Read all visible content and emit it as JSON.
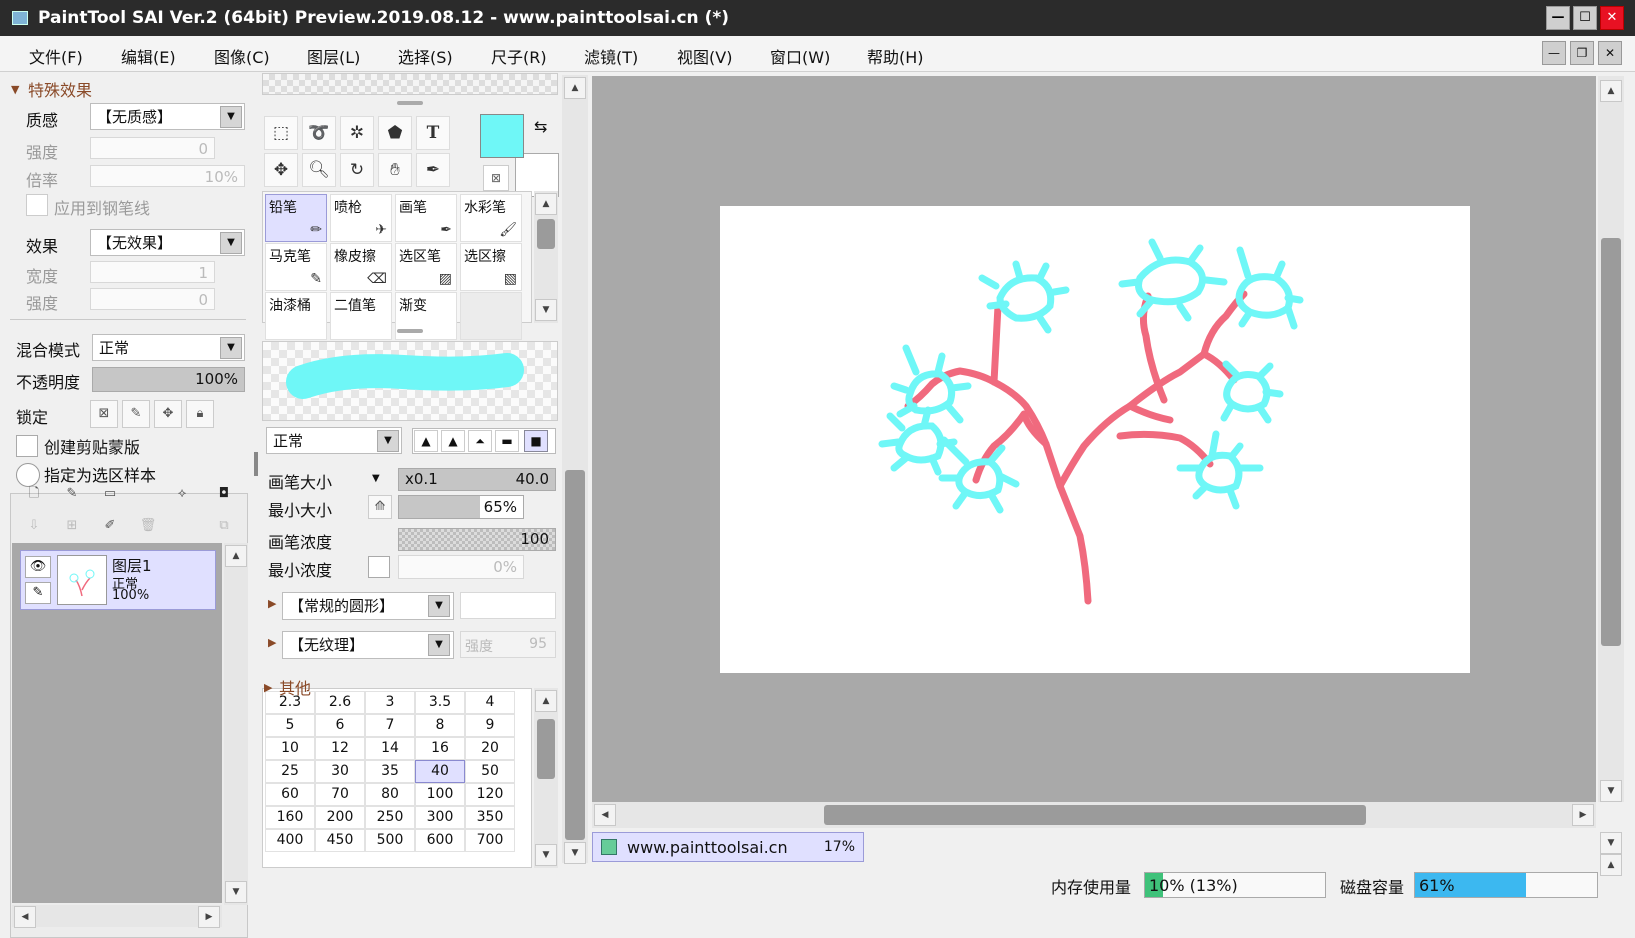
{
  "window": {
    "title": "PaintTool SAI Ver.2 (64bit) Preview.2019.08.12 - www.painttoolsai.cn (*)"
  },
  "menu": [
    "文件(F)",
    "编辑(E)",
    "图像(C)",
    "图层(L)",
    "选择(S)",
    "尺子(R)",
    "滤镜(T)",
    "视图(V)",
    "窗口(W)",
    "帮助(H)"
  ],
  "effects": {
    "header": "特殊效果",
    "texture_label": "质感",
    "texture_value": "【无质感】",
    "strength_label": "强度",
    "strength_value": "0",
    "scale_label": "倍率",
    "scale_value": "10%",
    "apply_pen": "应用到钢笔线",
    "effect_label": "效果",
    "effect_value": "【无效果】",
    "width_label": "宽度",
    "width_value": "1",
    "strength2_label": "强度",
    "strength2_value": "0"
  },
  "layer_props": {
    "blend_label": "混合模式",
    "blend_value": "正常",
    "opacity_label": "不透明度",
    "opacity_value": "100%",
    "opacity": 1.0,
    "lock_label": "锁定",
    "clip": "创建剪贴蒙版",
    "sample": "指定为选区样本"
  },
  "layers": [
    {
      "name": "图层1",
      "mode": "正常",
      "opacity": "100%"
    }
  ],
  "colors": {
    "primary": "#6ff7f7",
    "secondary": "#ffffff",
    "accent": "#f06a7e",
    "select": "#e0e0ff"
  },
  "brushes": [
    [
      "铅笔",
      "喷枪",
      "画笔",
      "水彩笔"
    ],
    [
      "马克笔",
      "橡皮擦",
      "选区笔",
      "选区擦"
    ],
    [
      "油漆桶",
      "二值笔",
      "渐变",
      ""
    ]
  ],
  "brush_settings": {
    "blend": "正常",
    "size_label": "画笔大小",
    "size_mult": "x0.1",
    "size_value": "40.0",
    "min_size_label": "最小大小",
    "min_size_value": "65%",
    "min_size": 0.65,
    "density_label": "画笔浓度",
    "density_value": "100",
    "min_density_label": "最小浓度",
    "min_density_value": "0%",
    "shape": "【常规的圆形】",
    "texture": "【无纹理】",
    "texture_strength_label": "强度",
    "texture_strength": "95",
    "other": "其他"
  },
  "size_grid": [
    [
      "2.3",
      "2.6",
      "3",
      "3.5",
      "4"
    ],
    [
      "5",
      "6",
      "7",
      "8",
      "9"
    ],
    [
      "10",
      "12",
      "14",
      "16",
      "20"
    ],
    [
      "25",
      "30",
      "35",
      "40",
      "50"
    ],
    [
      "60",
      "70",
      "80",
      "100",
      "120"
    ],
    [
      "160",
      "200",
      "250",
      "300",
      "350"
    ],
    [
      "400",
      "450",
      "500",
      "600",
      "700"
    ]
  ],
  "tab": {
    "name": "www.painttoolsai.cn",
    "zoom": "17%"
  },
  "status": {
    "mem_label": "内存使用量",
    "mem_value": "10% (13%)",
    "mem": 0.1,
    "disk_label": "磁盘容量",
    "disk_value": "61%",
    "disk": 0.61
  }
}
